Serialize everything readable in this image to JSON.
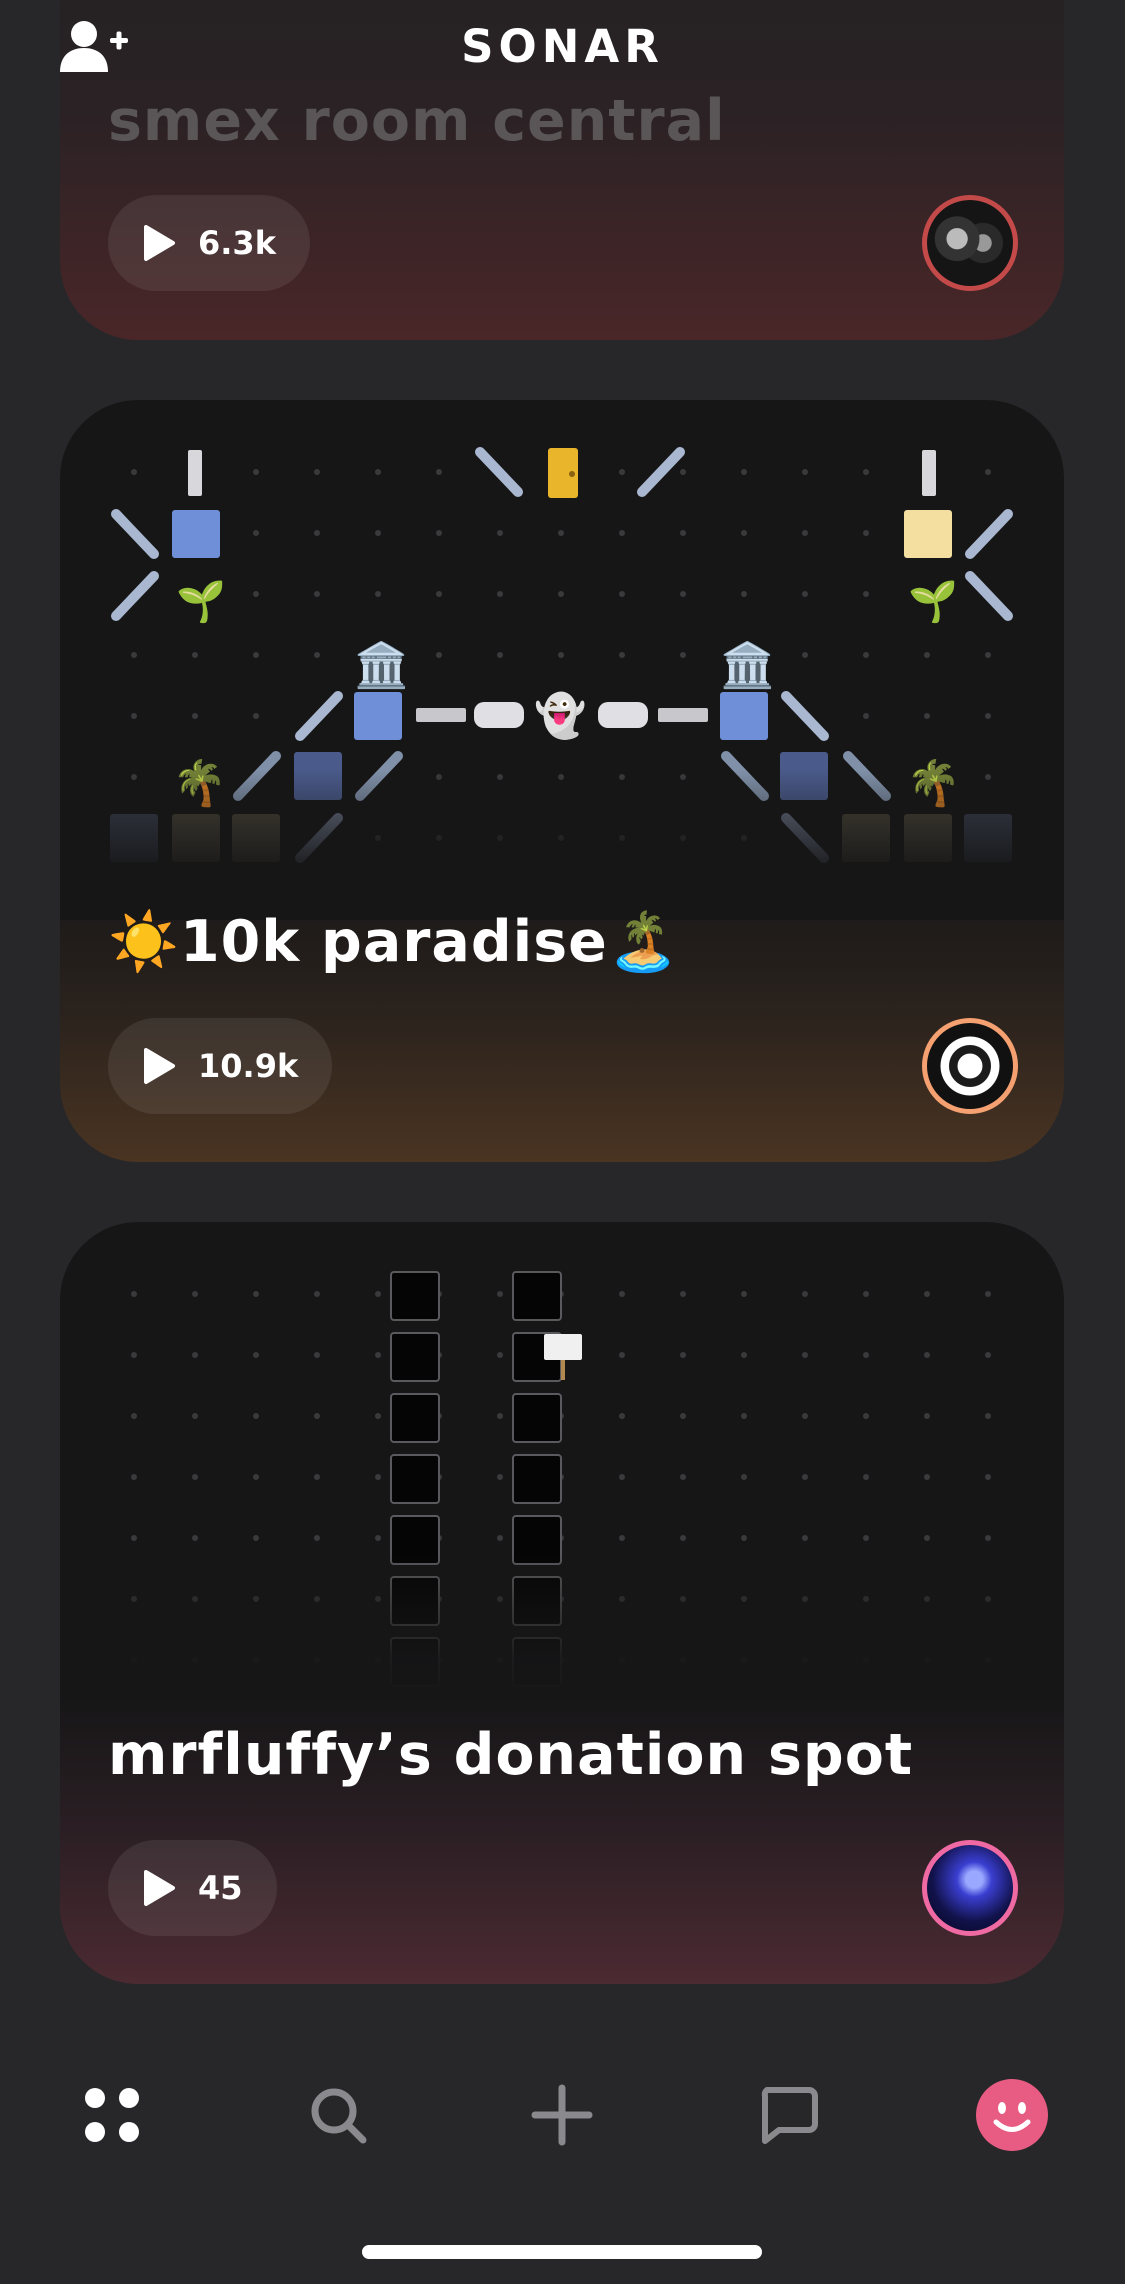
{
  "header": {
    "title": "SONAR",
    "add_friend_icon": "add-user-icon"
  },
  "rooms": [
    {
      "title": "smex room central",
      "plays": "6.3k",
      "play_icon": "play-icon",
      "avatar": "skulls-avatar"
    },
    {
      "title": "☀️10k paradise🏝️",
      "plays": "10.9k",
      "play_icon": "play-icon",
      "avatar": "swirl-logo-avatar",
      "center_emoji": "👻"
    },
    {
      "title": "mrfluffy’s donation spot",
      "plays": "45",
      "play_icon": "play-icon",
      "avatar": "storm-avatar"
    }
  ],
  "navbar": {
    "items": [
      {
        "name": "explore",
        "icon": "grid-dots-icon"
      },
      {
        "name": "search",
        "icon": "search-icon"
      },
      {
        "name": "create",
        "icon": "plus-icon"
      },
      {
        "name": "messages",
        "icon": "chat-bubble-icon"
      },
      {
        "name": "profile",
        "icon": "smiley-avatar-icon"
      }
    ]
  },
  "colors": {
    "background": "#272729",
    "card": "#161617",
    "profile_pink": "#e85c84",
    "avatar_ring_orange": "#f4a070",
    "avatar_ring_pink": "#ef6aa3"
  }
}
